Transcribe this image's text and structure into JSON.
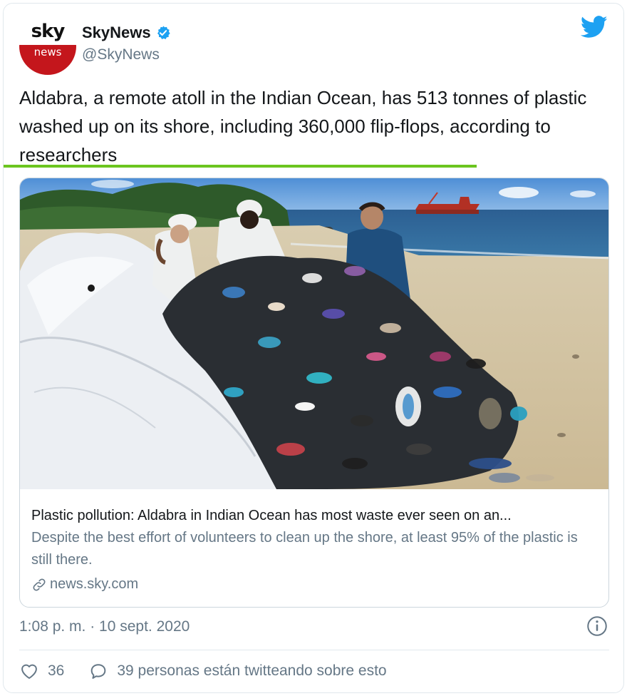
{
  "account": {
    "avatar_top": "sky",
    "avatar_bottom": "news",
    "display_name": "SkyNews",
    "handle": "@SkyNews",
    "verified_icon": "verified-badge-icon",
    "brand_icon": "twitter-bird-icon"
  },
  "tweet": {
    "text": "Aldabra, a remote atoll in the Indian Ocean, has 513 tonnes of plastic washed up on its shore, including 360,000 flip-flops, according to researchers"
  },
  "card": {
    "image_alt": "researchers-with-pile-of-flip-flops-on-beach",
    "title": "Plastic pollution: Aldabra in Indian Ocean has most waste ever seen on an...",
    "description": "Despite the best effort of volunteers to clean up the shore, at least 95% of the plastic is still there.",
    "link_icon": "link-icon",
    "domain": "news.sky.com"
  },
  "meta": {
    "timestamp": "1:08 p. m. · 10 sept. 2020",
    "info_icon": "info-icon"
  },
  "actions": {
    "likes": "36",
    "conversation": "39 personas están twitteando sobre esto"
  },
  "colors": {
    "accent_blue": "#1da1f2",
    "sky_red": "#c4161c",
    "highlight_green": "#6bc51f",
    "secondary_text": "#657786"
  }
}
